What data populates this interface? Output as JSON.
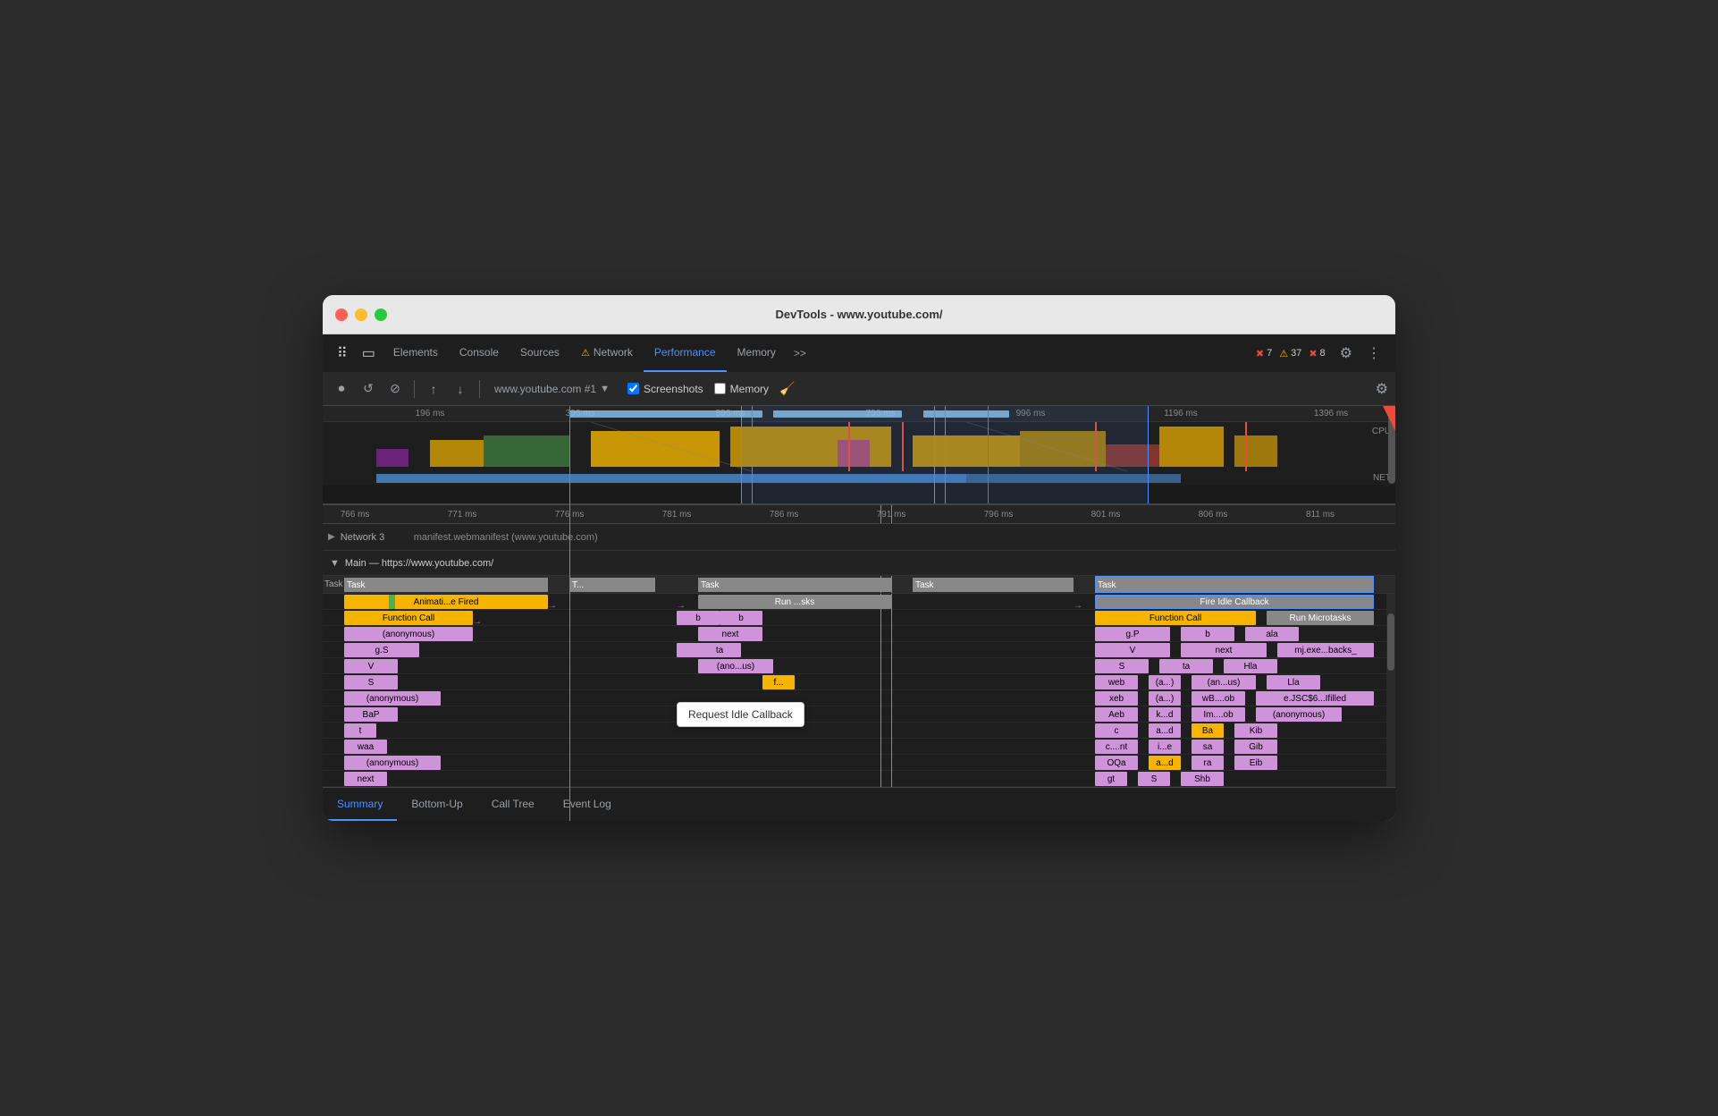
{
  "window": {
    "title": "DevTools - www.youtube.com/"
  },
  "tabs": {
    "items": [
      {
        "label": "Elements",
        "active": false,
        "warn": false
      },
      {
        "label": "Console",
        "active": false,
        "warn": false
      },
      {
        "label": "Sources",
        "active": false,
        "warn": false
      },
      {
        "label": "Network",
        "active": false,
        "warn": true
      },
      {
        "label": "Performance",
        "active": true,
        "warn": false
      },
      {
        "label": "Memory",
        "active": false,
        "warn": false
      }
    ],
    "more_label": ">>",
    "errors_count": "7",
    "warnings_count": "37",
    "info_count": "8"
  },
  "toolbar": {
    "url": "www.youtube.com #1",
    "screenshots_label": "Screenshots",
    "memory_label": "Memory",
    "screenshots_checked": true,
    "memory_checked": false
  },
  "timeline": {
    "ruler_marks": [
      "196 ms",
      "396 ms",
      "596 ms",
      "796 ms",
      "996 ms",
      "1196 ms",
      "1396 ms"
    ],
    "zoomed_marks": [
      "766 ms",
      "771 ms",
      "776 ms",
      "781 ms",
      "786 ms",
      "791 ms",
      "796 ms",
      "801 ms",
      "806 ms",
      "811 ms"
    ]
  },
  "network_row": {
    "label": "Network 3",
    "desc": "manifest.webmanifest (www.youtube.com)"
  },
  "main_section": {
    "label": "Main — https://www.youtube.com/"
  },
  "flame": {
    "task_headers": [
      "Task",
      "T...",
      "Task",
      "Task",
      "Task"
    ],
    "rows": [
      {
        "label": "Animati...e Fired",
        "color": "yellow"
      },
      {
        "label": "Function Call",
        "color": "yellow"
      },
      {
        "label": "(anonymous)",
        "color": "lightpurple"
      },
      {
        "label": "g.S",
        "color": "lightpurple"
      },
      {
        "label": "V",
        "color": "lightpurple"
      },
      {
        "label": "S",
        "color": "lightpurple"
      },
      {
        "label": "(anonymous)",
        "color": "lightpurple"
      },
      {
        "label": "BaP",
        "color": "lightpurple"
      },
      {
        "label": "t",
        "color": "lightpurple"
      },
      {
        "label": "waa",
        "color": "lightpurple"
      },
      {
        "label": "(anonymous)",
        "color": "lightpurple"
      },
      {
        "label": "next",
        "color": "lightpurple"
      }
    ],
    "middle_col": [
      {
        "label": "Run ...sks",
        "color": "gray"
      },
      {
        "label": "b",
        "color": "lightpurple"
      },
      {
        "label": "next",
        "color": "lightpurple"
      },
      {
        "label": "ta",
        "color": "lightpurple"
      },
      {
        "label": "(ano...us)",
        "color": "lightpurple"
      },
      {
        "label": "f...",
        "color": "yellow"
      }
    ],
    "right_col": [
      {
        "label": "Fire Idle Callback",
        "color": "gray",
        "highlighted": true
      },
      {
        "label": "Function Call",
        "color": "yellow"
      },
      {
        "label": "Run Microtasks",
        "color": "gray"
      },
      {
        "label": "g.P",
        "color": "lightpurple"
      },
      {
        "label": "b",
        "color": "lightpurple"
      },
      {
        "label": "ala",
        "color": "lightpurple"
      },
      {
        "label": "V",
        "color": "lightpurple"
      },
      {
        "label": "next",
        "color": "lightpurple"
      },
      {
        "label": "mj.exe...backs_",
        "color": "lightpurple"
      },
      {
        "label": "S",
        "color": "lightpurple"
      },
      {
        "label": "ta",
        "color": "lightpurple"
      },
      {
        "label": "Hla",
        "color": "lightpurple"
      },
      {
        "label": "web",
        "color": "lightpurple"
      },
      {
        "label": "(a...)",
        "color": "lightpurple"
      },
      {
        "label": "(an...us)",
        "color": "lightpurple"
      },
      {
        "label": "Lla",
        "color": "lightpurple"
      },
      {
        "label": "xeb",
        "color": "lightpurple"
      },
      {
        "label": "(a...)",
        "color": "lightpurple"
      },
      {
        "label": "wB....ob",
        "color": "lightpurple"
      },
      {
        "label": "e.JSC$6...Ifilled",
        "color": "lightpurple"
      },
      {
        "label": "Aeb",
        "color": "lightpurple"
      },
      {
        "label": "k...d",
        "color": "lightpurple"
      },
      {
        "label": "Im....ob",
        "color": "lightpurple"
      },
      {
        "label": "(anonymous)",
        "color": "lightpurple"
      },
      {
        "label": "c",
        "color": "lightpurple"
      },
      {
        "label": "a...d",
        "color": "lightpurple"
      },
      {
        "label": "Ba",
        "color": "yellow"
      },
      {
        "label": "Kib",
        "color": "lightpurple"
      },
      {
        "label": "c....nt",
        "color": "lightpurple"
      },
      {
        "label": "i...e",
        "color": "lightpurple"
      },
      {
        "label": "sa",
        "color": "lightpurple"
      },
      {
        "label": "Gib",
        "color": "lightpurple"
      },
      {
        "label": "OQa",
        "color": "lightpurple"
      },
      {
        "label": "a...d",
        "color": "yellow"
      },
      {
        "label": "ra",
        "color": "lightpurple"
      },
      {
        "label": "Eib",
        "color": "lightpurple"
      },
      {
        "label": "gt",
        "color": "lightpurple"
      },
      {
        "label": "S",
        "color": "lightpurple"
      },
      {
        "label": "Shb",
        "color": "lightpurple"
      }
    ]
  },
  "tooltip": {
    "label": "Request Idle Callback"
  },
  "bottom_tabs": [
    {
      "label": "Summary",
      "active": true
    },
    {
      "label": "Bottom-Up",
      "active": false
    },
    {
      "label": "Call Tree",
      "active": false
    },
    {
      "label": "Event Log",
      "active": false
    }
  ],
  "left_col_blocks": [
    {
      "label": "b",
      "color": "lightpurple"
    },
    {
      "label": "b",
      "color": "lightpurple"
    },
    {
      "label": "ta",
      "color": "lightpurple"
    },
    {
      "label": "ta",
      "color": "lightpurple"
    }
  ]
}
